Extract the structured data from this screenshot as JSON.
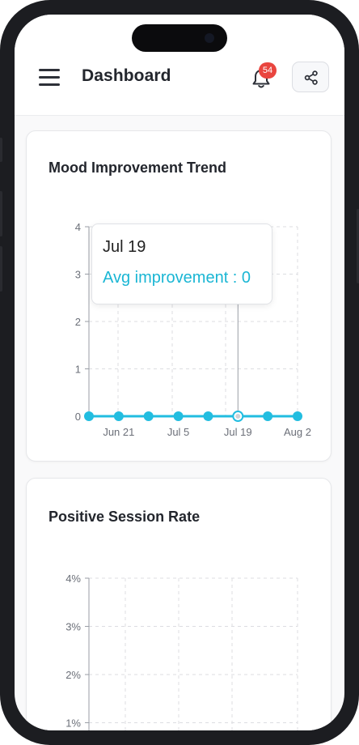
{
  "header": {
    "title": "Dashboard",
    "notification_count": "54",
    "menu_icon": "hamburger-menu-icon",
    "bell_icon": "bell-icon",
    "share_icon": "share-icon"
  },
  "colors": {
    "accent": "#22bde0",
    "badge": "#e9453f",
    "tooltip_value": "#1ab6d4"
  },
  "tooltip": {
    "date": "Jul 19",
    "value_text": "Avg improvement : 0"
  },
  "cards": [
    {
      "title": "Mood Improvement Trend"
    },
    {
      "title": "Positive Session Rate"
    }
  ],
  "chart_data": [
    {
      "type": "line",
      "title": "Mood Improvement Trend",
      "y_ticks": [
        "0",
        "1",
        "2",
        "3",
        "4"
      ],
      "ylim": [
        0,
        4
      ],
      "x_tick_labels": [
        "Jun 21",
        "Jul 5",
        "Jul 19",
        "Aug 2"
      ],
      "series": [
        {
          "values": [
            0,
            0,
            0,
            0,
            0,
            0,
            0,
            0
          ]
        }
      ],
      "highlighted_point_index": 5,
      "grid": true
    },
    {
      "type": "line",
      "title": "Positive Session Rate",
      "y_ticks": [
        "1%",
        "2%",
        "3%",
        "4%"
      ],
      "ylim": [
        0,
        4
      ],
      "x_tick_labels": [],
      "series": [],
      "grid": true
    }
  ]
}
